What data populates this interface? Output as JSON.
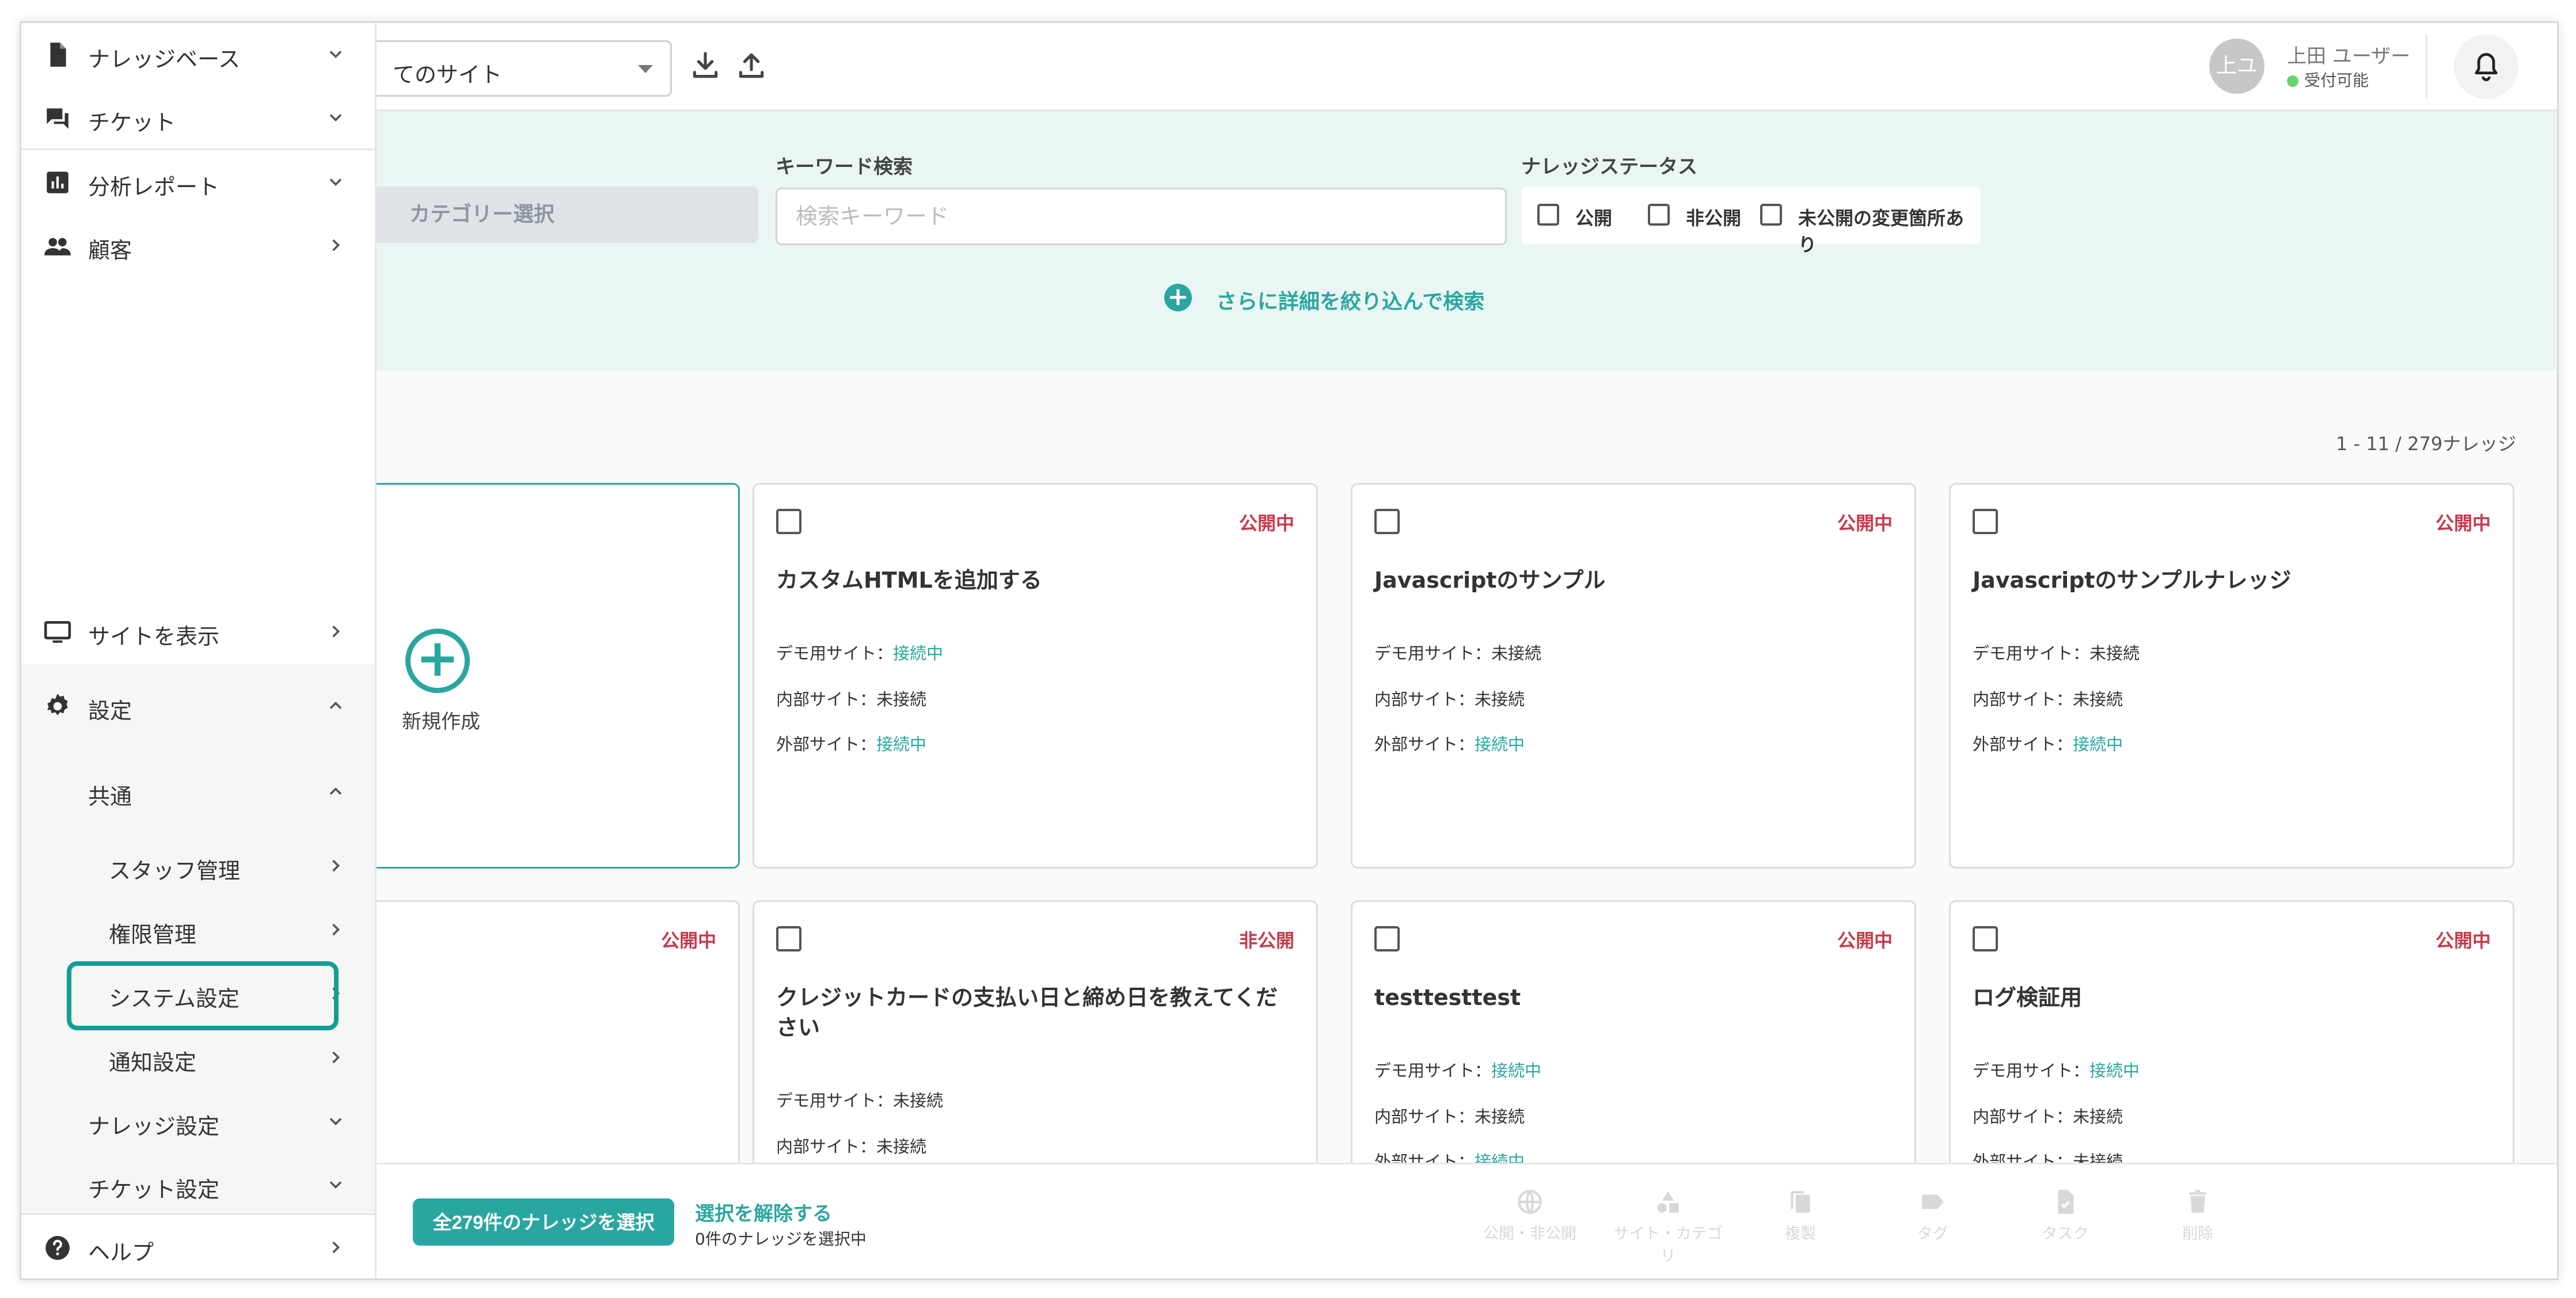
{
  "header": {
    "site_select": "てのサイト",
    "user_initials": "上ユ",
    "user_name": "上田 ユーザー",
    "user_status": "受付可能"
  },
  "filter": {
    "category_placeholder": "カテゴリー選択",
    "keyword_label": "キーワード検索",
    "keyword_placeholder": "検索キーワード",
    "status_label": "ナレッジステータス",
    "status_options": [
      "公開",
      "非公開",
      "未公開の変更箇所あり"
    ],
    "more_search": "さらに詳細を絞り込んで検索"
  },
  "count": "1 - 11 / 279ナレッジ",
  "new_card_label": "新規作成",
  "cards": [
    {
      "badge": "公開中",
      "title": "カスタムHTMLを追加する",
      "rows": [
        {
          "k": "デモ用サイト：",
          "v": "接続中"
        },
        {
          "k": "内部サイト：",
          "v": "未接続"
        },
        {
          "k": "外部サイト：",
          "v": "接続中"
        }
      ]
    },
    {
      "badge": "公開中",
      "title": "Javascriptのサンプル",
      "rows": [
        {
          "k": "デモ用サイト：",
          "v": "未接続"
        },
        {
          "k": "内部サイト：",
          "v": "未接続"
        },
        {
          "k": "外部サイト：",
          "v": "接続中"
        }
      ]
    },
    {
      "badge": "公開中",
      "title": "Javascriptのサンプルナレッジ",
      "rows": [
        {
          "k": "デモ用サイト：",
          "v": "未接続"
        },
        {
          "k": "内部サイト：",
          "v": "未接続"
        },
        {
          "k": "外部サイト：",
          "v": "接続中"
        }
      ]
    },
    {
      "badge": "公開中"
    },
    {
      "badge": "非公開",
      "title": "クレジットカードの支払い日と締め日を教えてください",
      "rows": [
        {
          "k": "デモ用サイト：",
          "v": "未接続"
        },
        {
          "k": "内部サイト：",
          "v": "未接続"
        }
      ]
    },
    {
      "badge": "公開中",
      "title": "testtesttest",
      "rows": [
        {
          "k": "デモ用サイト：",
          "v": "接続中"
        },
        {
          "k": "内部サイト：",
          "v": "未接続"
        },
        {
          "k": "外部サイト：",
          "v": "接続中"
        }
      ]
    },
    {
      "badge": "公開中",
      "title": "ログ検証用",
      "rows": [
        {
          "k": "デモ用サイト：",
          "v": "接続中"
        },
        {
          "k": "内部サイト：",
          "v": "未接続"
        },
        {
          "k": "外部サイト：",
          "v": "未接続"
        }
      ]
    }
  ],
  "bottom": {
    "select_all": "全279件のナレッジを選択",
    "unselect": "選択を解除する",
    "selected_count": "0件のナレッジを選択中",
    "tools": [
      "公開・非公開",
      "サイト・カテゴリ",
      "複製",
      "タグ",
      "タスク",
      "削除"
    ]
  },
  "sidebar": {
    "knowledge_base": "ナレッジベース",
    "tickets": "チケット",
    "reports": "分析レポート",
    "customers": "顧客",
    "view_site": "サイトを表示",
    "settings": "設定",
    "common": "共通",
    "staff": "スタッフ管理",
    "permissions": "権限管理",
    "system": "システム設定",
    "notifications": "通知設定",
    "knowledge_settings": "ナレッジ設定",
    "ticket_settings": "チケット設定",
    "help": "ヘルプ"
  },
  "colors": {
    "accent": "#2aa6a0",
    "badge_red": "#c8384a",
    "filter_bg": "#e9f6f4",
    "highlight": "#129e95"
  }
}
